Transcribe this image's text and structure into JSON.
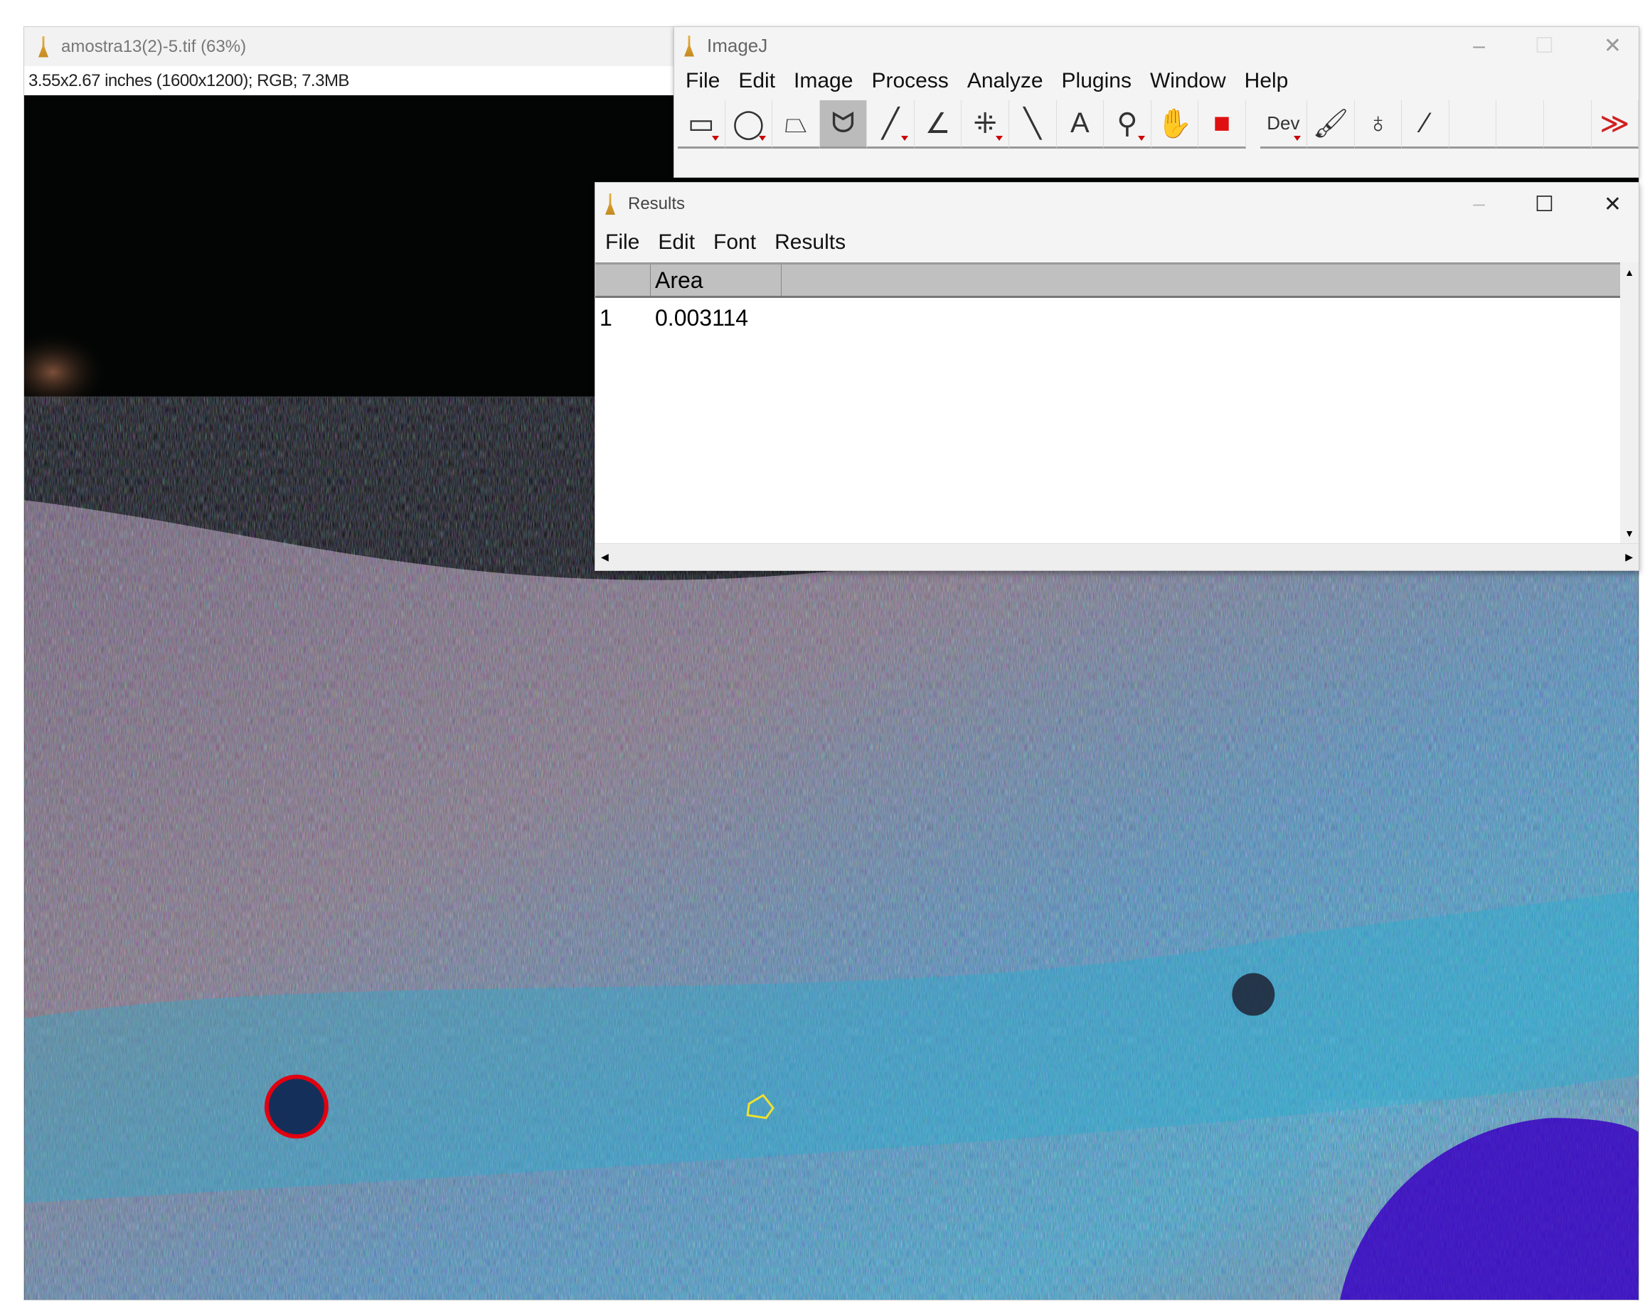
{
  "image_window": {
    "title": "amostra13(2)-5.tif (63%)",
    "info": "3.55x2.67 inches (1600x1200); RGB; 7.3MB"
  },
  "imagej_window": {
    "title": "ImageJ",
    "menu": [
      "File",
      "Edit",
      "Image",
      "Process",
      "Analyze",
      "Plugins",
      "Window",
      "Help"
    ],
    "tools": [
      {
        "name": "rectangle-tool",
        "glyph": "▭",
        "tri": true
      },
      {
        "name": "oval-tool",
        "glyph": "◯",
        "tri": true
      },
      {
        "name": "polygon-tool",
        "glyph": "⏢"
      },
      {
        "name": "freehand-tool",
        "glyph": "ᗢ",
        "selected": true
      },
      {
        "name": "line-tool",
        "glyph": "╱",
        "tri": true
      },
      {
        "name": "angle-tool",
        "glyph": "∠"
      },
      {
        "name": "multipoint-tool",
        "glyph": "⁜",
        "tri": true
      },
      {
        "name": "wand-tool",
        "glyph": "╲"
      },
      {
        "name": "text-tool",
        "glyph": "A"
      },
      {
        "name": "magnifier-tool",
        "glyph": "⚲",
        "tri": true
      },
      {
        "name": "hand-tool",
        "glyph": "✋"
      },
      {
        "name": "color-picker-tool",
        "glyph": "■",
        "color": "#e01010"
      },
      {
        "gap": true
      },
      {
        "name": "developer-menu",
        "glyph": "Dev",
        "tri": true
      },
      {
        "name": "brush-tool",
        "glyph": "🖌"
      },
      {
        "name": "flood-fill-tool",
        "glyph": "♁"
      },
      {
        "name": "pipette-tool",
        "glyph": "⁄"
      },
      {
        "name": "empty-slot",
        "glyph": ""
      },
      {
        "name": "empty-slot",
        "glyph": ""
      },
      {
        "name": "empty-slot",
        "glyph": ""
      },
      {
        "name": "more-tools",
        "glyph": "≫",
        "color": "#d02020"
      }
    ]
  },
  "results_window": {
    "title": "Results",
    "menu": [
      "File",
      "Edit",
      "Font",
      "Results"
    ],
    "columns": [
      "",
      "Area"
    ],
    "rows": [
      [
        "1",
        "0.003114"
      ]
    ]
  },
  "window_controls": {
    "minimize": "–",
    "maximize": "☐",
    "close": "✕"
  }
}
